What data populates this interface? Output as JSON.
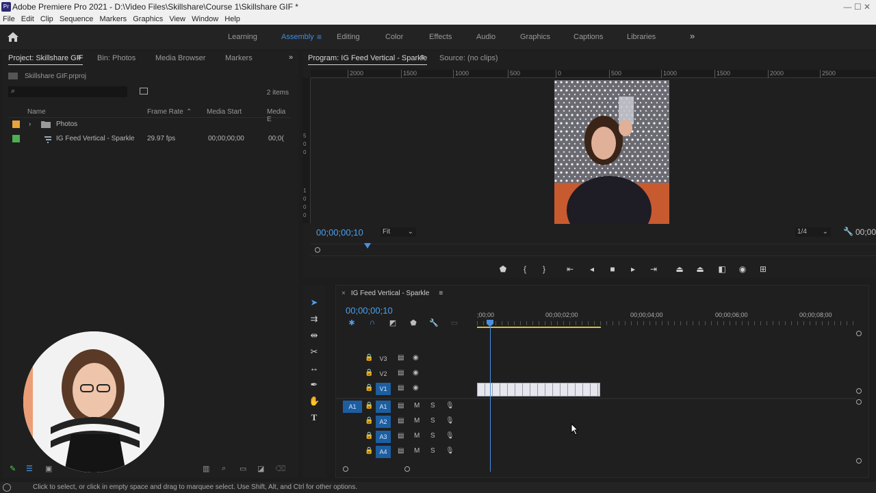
{
  "window": {
    "title": "Adobe Premiere Pro 2021 - D:\\Video Files\\Skillshare\\Course 1\\Skillshare GIF *",
    "app_badge": "Pr",
    "controls": "—  ☐  ✕"
  },
  "menu": [
    "File",
    "Edit",
    "Clip",
    "Sequence",
    "Markers",
    "Graphics",
    "View",
    "Window",
    "Help"
  ],
  "workspaces": {
    "items": [
      "Learning",
      "Assembly",
      "Editing",
      "Color",
      "Effects",
      "Audio",
      "Graphics",
      "Captions",
      "Libraries"
    ],
    "active": "Assembly",
    "menu_glyph": "≡",
    "more_glyph": "»"
  },
  "project_panel": {
    "tabs": [
      "Project: Skillshare GIF",
      "Bin: Photos",
      "Media Browser",
      "Markers"
    ],
    "menu_glyph": "≡",
    "more_glyph": "»",
    "project_file": "Skillshare GIF.prproj",
    "item_count": "2 items",
    "columns": [
      "Name",
      "Frame Rate",
      "Media Start",
      "Media E"
    ],
    "rows": [
      {
        "name": "Photos",
        "frame_rate": "",
        "media_start": "",
        "media_end": "",
        "label_color": "#e8a33c",
        "icon": "folder-icon",
        "expander": "›"
      },
      {
        "name": "IG Feed Vertical - Sparkle",
        "frame_rate": "29.97 fps",
        "media_start": "00;00;00;00",
        "media_end": "00;0(",
        "label_color": "#4caf50",
        "icon": "sequence-icon",
        "expander": ""
      }
    ]
  },
  "program_monitor": {
    "tabs": [
      "Program: IG Feed Vertical - Sparkle",
      "Source: (no clips)"
    ],
    "menu_glyph": "≡",
    "ruler_labels": [
      "2000",
      "1500",
      "1000",
      "500",
      "0",
      "500",
      "1000",
      "1500",
      "2000",
      "2500"
    ],
    "vruler_labels": [
      "5",
      "0",
      "0",
      "1",
      "0",
      "0",
      "0"
    ],
    "timecode": "00;00;00;10",
    "zoom": "Fit",
    "resolution": "1/4",
    "timecode_right": "00;00",
    "accent_color": "#4aa0f0"
  },
  "timeline": {
    "sequence_name": "IG Feed Vertical - Sparkle",
    "close_glyph": "×",
    "menu_glyph": "≡",
    "timecode": "00;00;00;10",
    "ruler_labels": [
      ";00;00",
      "00;00;02;00",
      "00;00;04;00",
      "00;00;06;00",
      "00;00;08;00"
    ],
    "video_tracks": [
      {
        "name": "V3",
        "selected": false
      },
      {
        "name": "V2",
        "selected": false
      },
      {
        "name": "V1",
        "selected": true
      }
    ],
    "audio_tracks": [
      {
        "name": "A1",
        "source": "A1",
        "mute": "M",
        "solo": "S"
      },
      {
        "name": "A2",
        "source": "",
        "mute": "M",
        "solo": "S"
      },
      {
        "name": "A3",
        "source": "",
        "mute": "M",
        "solo": "S"
      },
      {
        "name": "A4",
        "source": "",
        "mute": "M",
        "solo": "S"
      }
    ],
    "workarea_color": "#d4c43a",
    "playhead_color": "#4a90e2"
  },
  "status": {
    "message": "Click to select, or click in empty space and drag to marquee select. Use Shift, Alt, and Ctrl for other options."
  }
}
